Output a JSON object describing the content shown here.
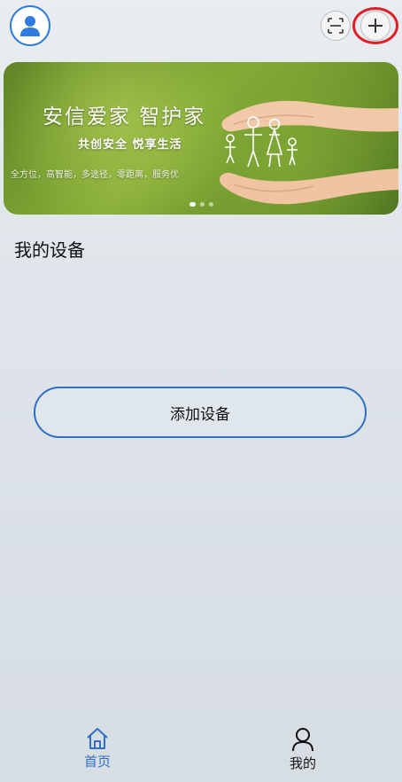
{
  "header": {
    "avatar_icon": "user-avatar-icon",
    "scan_icon": "scan-icon",
    "add_icon": "plus-icon",
    "accent_color": "#2f7be0",
    "highlight_color": "#e01e25"
  },
  "banner": {
    "title": "安信爱家  智护家",
    "subtitle": "共创安全 悦享生活",
    "tagline": "全方位，高智能，多途径，零距离，服务优",
    "slide_count": 3,
    "active_slide": 1
  },
  "main": {
    "section_title": "我的设备",
    "add_device_label": "添加设备"
  },
  "tabbar": {
    "home_label": "首页",
    "home_icon": "home-icon",
    "mine_label": "我的",
    "mine_icon": "person-icon"
  }
}
